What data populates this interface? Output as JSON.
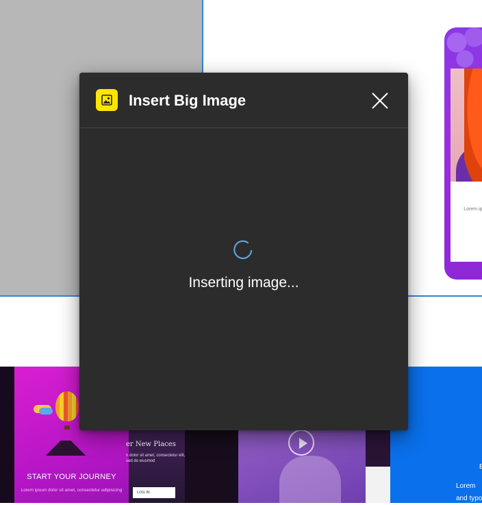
{
  "dialog": {
    "title": "Insert Big Image",
    "status_text": "Inserting image...",
    "plugin_icon": "image-icon",
    "close_icon": "close-icon",
    "spinner_icon": "loading-spinner-icon"
  },
  "canvas": {
    "phone_card_text": "Lorem ip adipis",
    "journey_title": "START YOUR JOURNEY",
    "journey_subtitle": "Lorem ipsum dolor sit amet, consectetur adipisicing",
    "new_places_title": "er New Places",
    "new_places_subtitle": "n dolor sit amet, consectetur elit, sed do eiusmod",
    "login_label": "LOG IN",
    "blue_letter": "E",
    "blue_line1": "Lorem",
    "blue_line2": "and typo"
  },
  "colors": {
    "dialog_bg": "#2c2c2c",
    "plugin_icon_bg": "#ffe600",
    "selection_blue": "#2f86d6",
    "spinner": "#5ba3e0"
  }
}
